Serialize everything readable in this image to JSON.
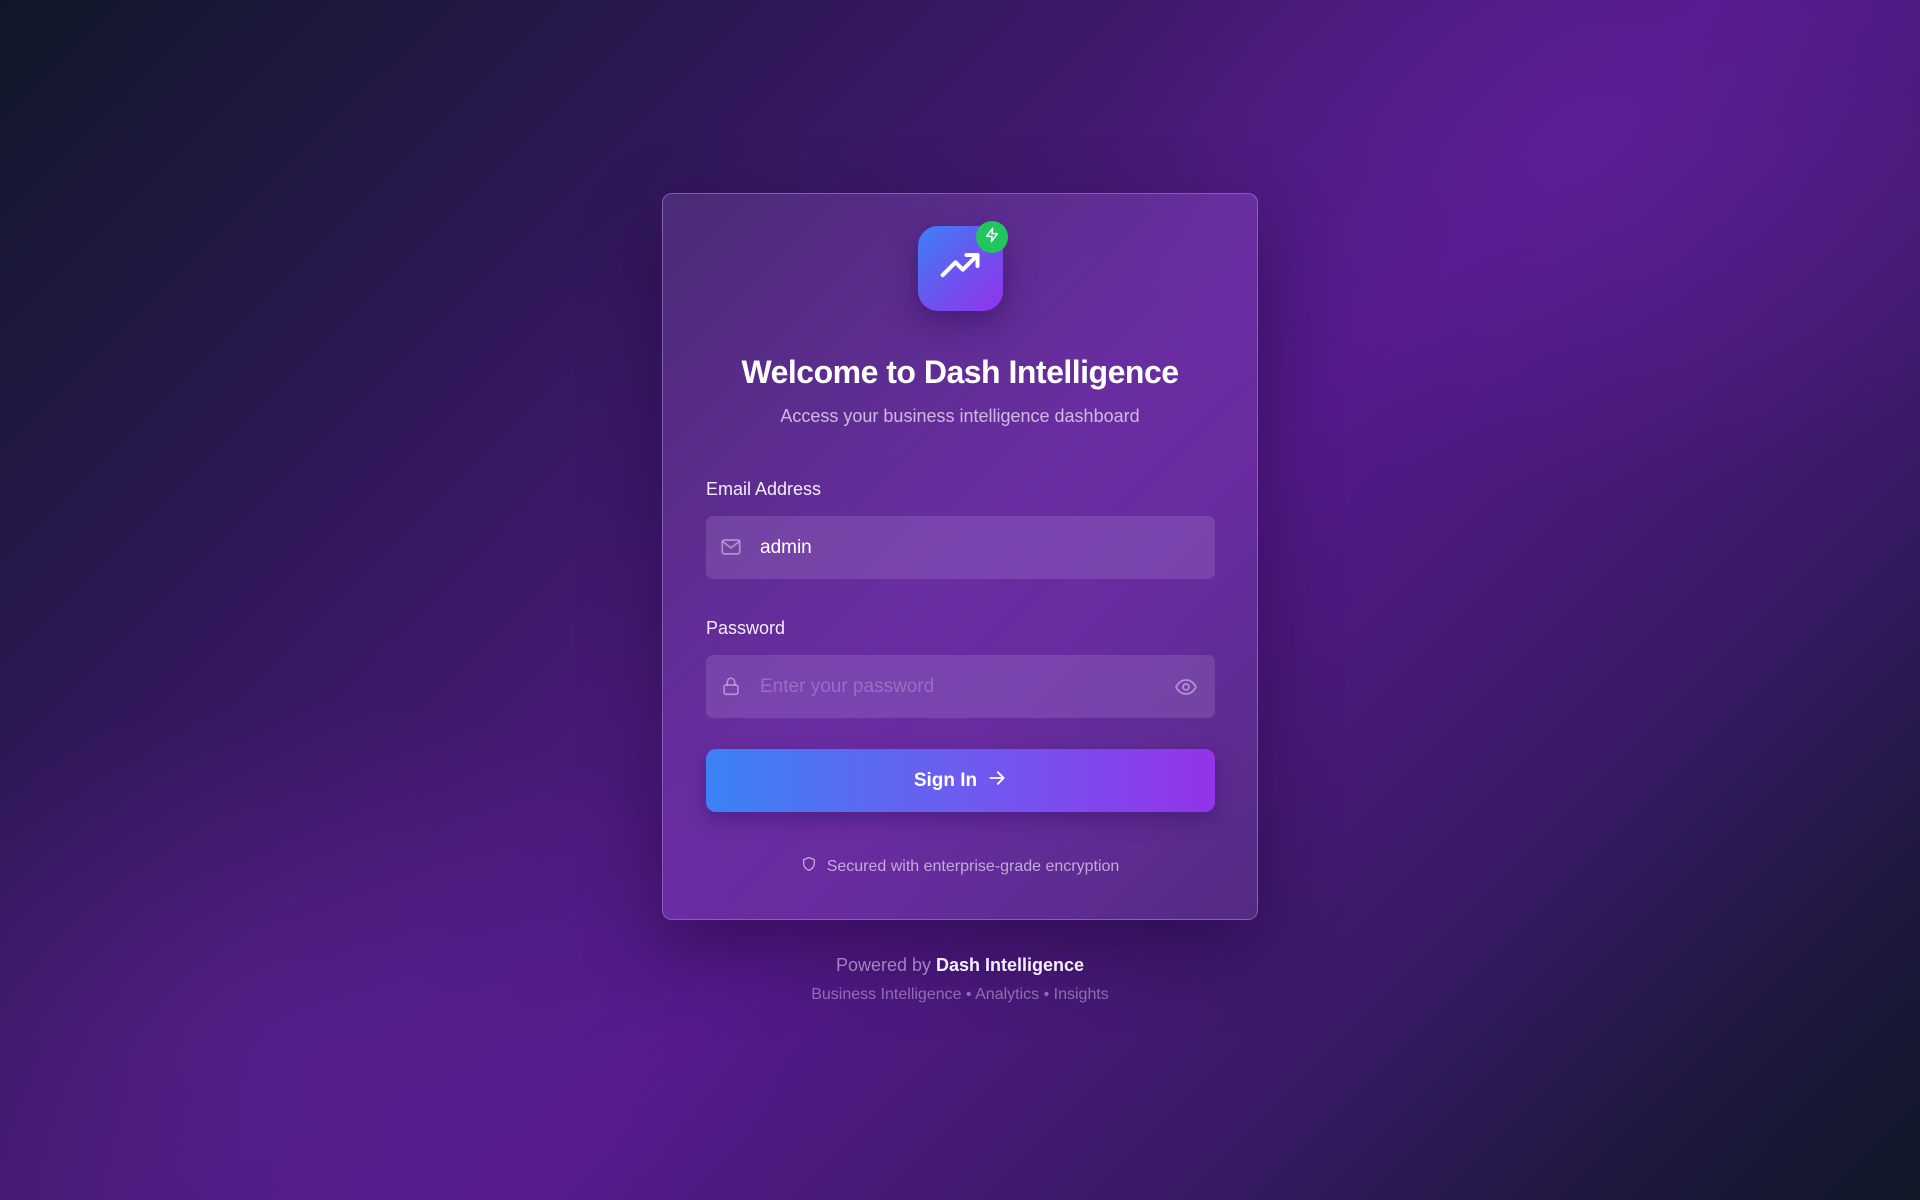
{
  "card": {
    "title": "Welcome to Dash Intelligence",
    "subtitle": "Access your business intelligence dashboard",
    "logo_icon": "trending-up-icon",
    "badge_icon": "lightning-icon",
    "badge_color": "#22c55e"
  },
  "form": {
    "email": {
      "label": "Email Address",
      "value": "admin",
      "icon": "mail-icon"
    },
    "password": {
      "label": "Password",
      "value": "",
      "placeholder": "Enter your password",
      "icon": "lock-icon",
      "toggle_icon": "eye-icon"
    },
    "submit": {
      "label": "Sign In",
      "icon": "arrow-right-icon"
    },
    "security_note": {
      "text": "Secured with enterprise-grade encryption",
      "icon": "shield-icon"
    }
  },
  "footer": {
    "powered_prefix": "Powered by",
    "brand": "Dash Intelligence",
    "tagline": "Business Intelligence • Analytics • Insights"
  },
  "colors": {
    "accent_start": "#3b82f6",
    "accent_end": "#9333ea",
    "success": "#22c55e"
  }
}
